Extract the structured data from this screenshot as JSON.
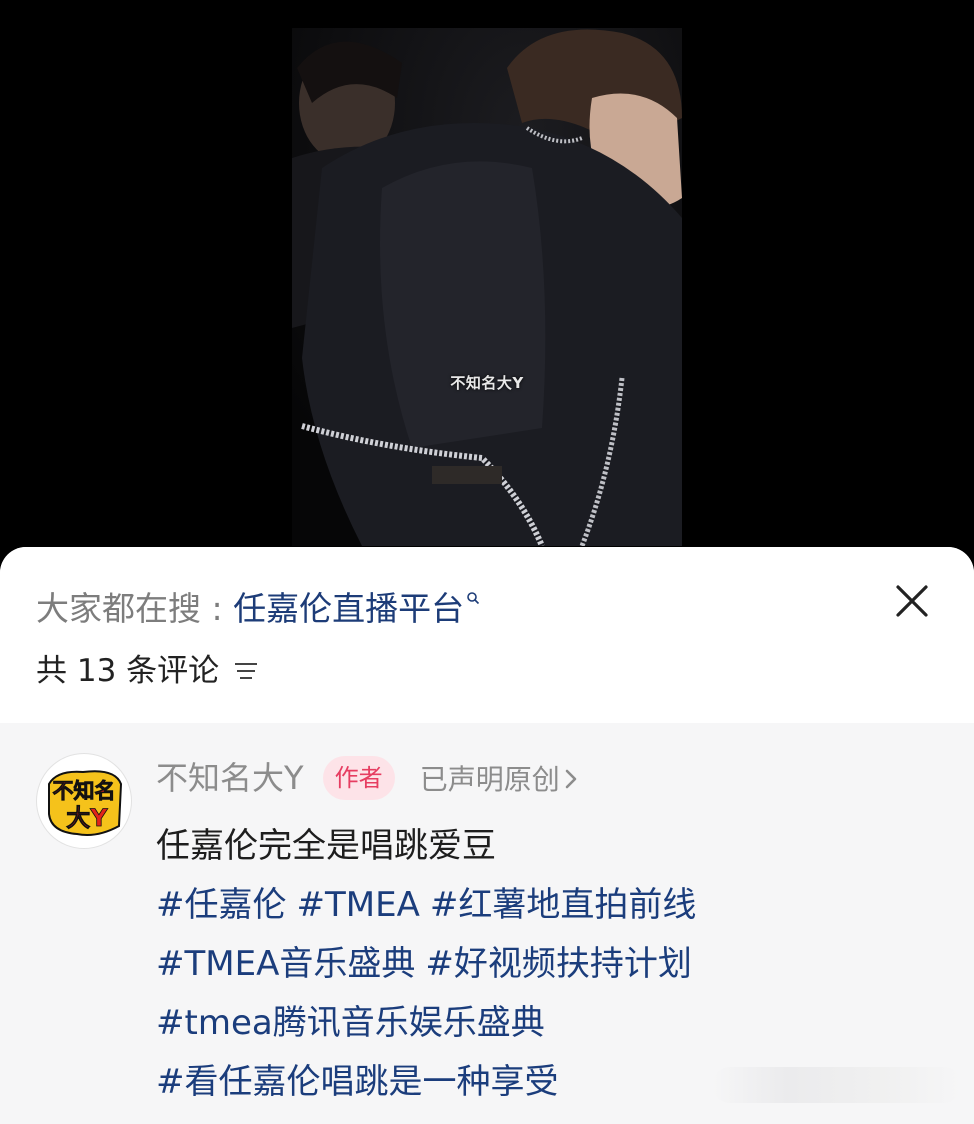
{
  "video": {
    "watermark": "不知名大Y"
  },
  "search": {
    "label": "大家都在搜 : ",
    "term": "任嘉伦直播平台"
  },
  "comments_header": {
    "count_text": "共 13 条评论"
  },
  "comment": {
    "username": "不知名大Y",
    "author_badge": "作者",
    "original_label": "已声明原创",
    "avatar_text": [
      "不知名",
      "大Y"
    ],
    "text": "任嘉伦完全是唱跳爱豆",
    "hashtag_lines": [
      [
        "#任嘉伦",
        "#TMEA",
        "#红薯地直拍前线"
      ],
      [
        "#TMEA音乐盛典",
        "#好视频扶持计划"
      ],
      [
        "#tmea腾讯音乐娱乐盛典"
      ],
      [
        "#看任嘉伦唱跳是一种享受"
      ]
    ]
  },
  "colors": {
    "link": "#1b3d7c",
    "badge_bg": "#fde3e8",
    "badge_text": "#e63d61",
    "muted": "#8c8c8c"
  },
  "icons": [
    "search-mini-icon",
    "close-icon",
    "sort-icon",
    "chevron-right-icon"
  ]
}
